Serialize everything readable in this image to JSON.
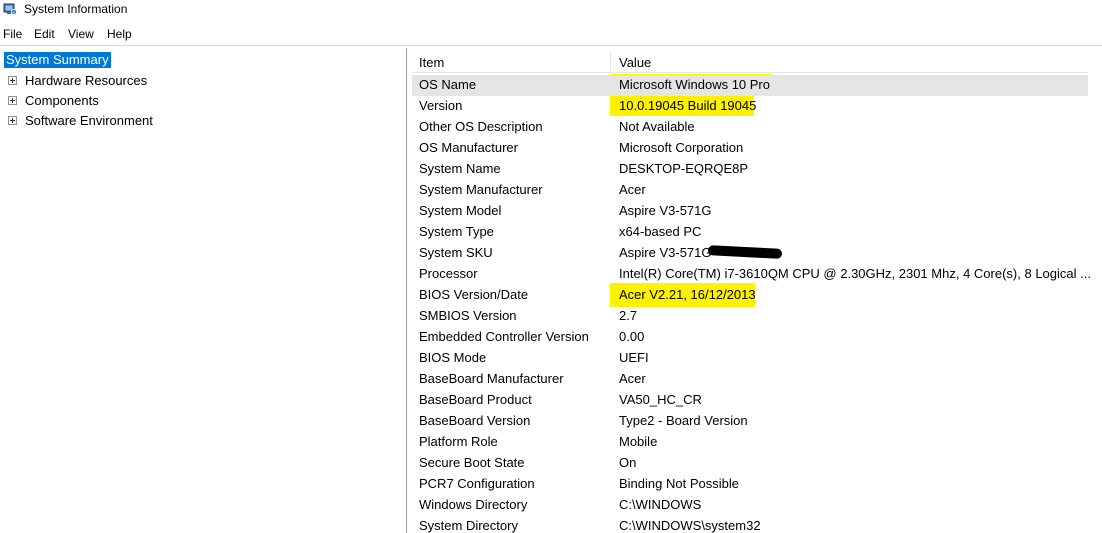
{
  "window": {
    "title": "System Information"
  },
  "menu": [
    "File",
    "Edit",
    "View",
    "Help"
  ],
  "tree": {
    "root": "System Summary",
    "children": [
      "Hardware Resources",
      "Components",
      "Software Environment"
    ]
  },
  "list": {
    "headers": {
      "item": "Item",
      "value": "Value"
    },
    "rows": [
      {
        "item": "OS Name",
        "value": "Microsoft Windows 10 Pro"
      },
      {
        "item": "Version",
        "value": "10.0.19045 Build 19045"
      },
      {
        "item": "Other OS Description",
        "value": "Not Available"
      },
      {
        "item": "OS Manufacturer",
        "value": "Microsoft Corporation"
      },
      {
        "item": "System Name",
        "value": "DESKTOP-EQRQE8P"
      },
      {
        "item": "System Manufacturer",
        "value": "Acer"
      },
      {
        "item": "System Model",
        "value": "Aspire V3-571G"
      },
      {
        "item": "System Type",
        "value": "x64-based PC"
      },
      {
        "item": "System SKU",
        "value": "Aspire V3-571G"
      },
      {
        "item": "Processor",
        "value": "Intel(R) Core(TM) i7-3610QM CPU @ 2.30GHz, 2301 Mhz, 4 Core(s), 8 Logical ..."
      },
      {
        "item": "BIOS Version/Date",
        "value": "Acer V2.21, 16/12/2013"
      },
      {
        "item": "SMBIOS Version",
        "value": "2.7"
      },
      {
        "item": "Embedded Controller Version",
        "value": "0.00"
      },
      {
        "item": "BIOS Mode",
        "value": "UEFI"
      },
      {
        "item": "BaseBoard Manufacturer",
        "value": "Acer"
      },
      {
        "item": "BaseBoard Product",
        "value": "VA50_HC_CR"
      },
      {
        "item": "BaseBoard Version",
        "value": "Type2 - Board Version"
      },
      {
        "item": "Platform Role",
        "value": "Mobile"
      },
      {
        "item": "Secure Boot State",
        "value": "On"
      },
      {
        "item": "PCR7 Configuration",
        "value": "Binding Not Possible"
      },
      {
        "item": "Windows Directory",
        "value": "C:\\WINDOWS"
      },
      {
        "item": "System Directory",
        "value": "C:\\WINDOWS\\system32"
      }
    ]
  },
  "colors": {
    "selection": "#0078d7",
    "highlight": "#fff200",
    "row_selected": "#e5e5e5"
  },
  "icons": {
    "app": "system-information-icon",
    "expander": "plus-box-icon"
  }
}
